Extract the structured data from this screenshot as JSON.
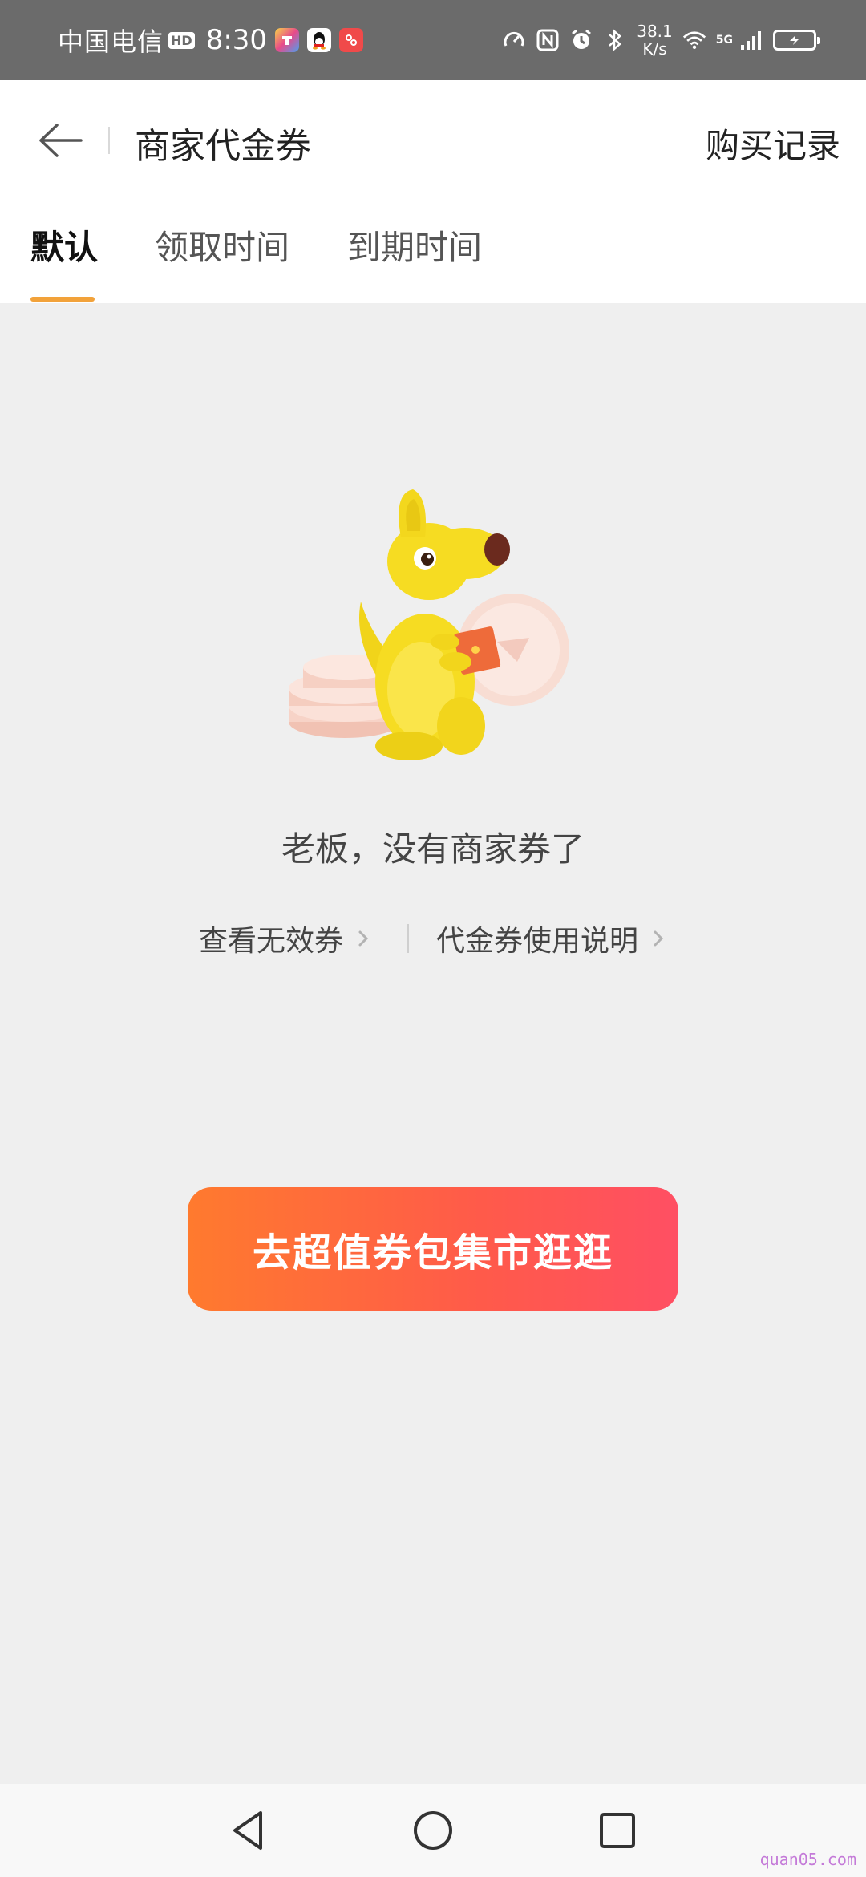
{
  "status_bar": {
    "carrier": "中国电信",
    "hd": "HD",
    "time": "8:30",
    "speed_value": "38.1",
    "speed_unit": "K/s",
    "network": "5G",
    "icons": [
      "app-icon-colorful",
      "qq-icon",
      "app-icon-red",
      "speedometer-icon",
      "nfc-icon",
      "alarm-icon",
      "bluetooth-icon",
      "wifi-icon",
      "signal-icon",
      "battery-charging-icon"
    ]
  },
  "header": {
    "title": "商家代金券",
    "right_action": "购买记录"
  },
  "tabs": [
    {
      "label": "默认",
      "active": true
    },
    {
      "label": "领取时间",
      "active": false
    },
    {
      "label": "到期时间",
      "active": false
    }
  ],
  "empty_state": {
    "message": "老板，没有商家券了",
    "links": [
      {
        "label": "查看无效券"
      },
      {
        "label": "代金券使用说明"
      }
    ],
    "cta_label": "去超值券包集市逛逛"
  },
  "watermark": "quan05.com",
  "colors": {
    "tab_indicator": "#f2a23a",
    "cta_start": "#ff7a2e",
    "cta_end": "#ff4f63",
    "page_background": "#efefef"
  }
}
